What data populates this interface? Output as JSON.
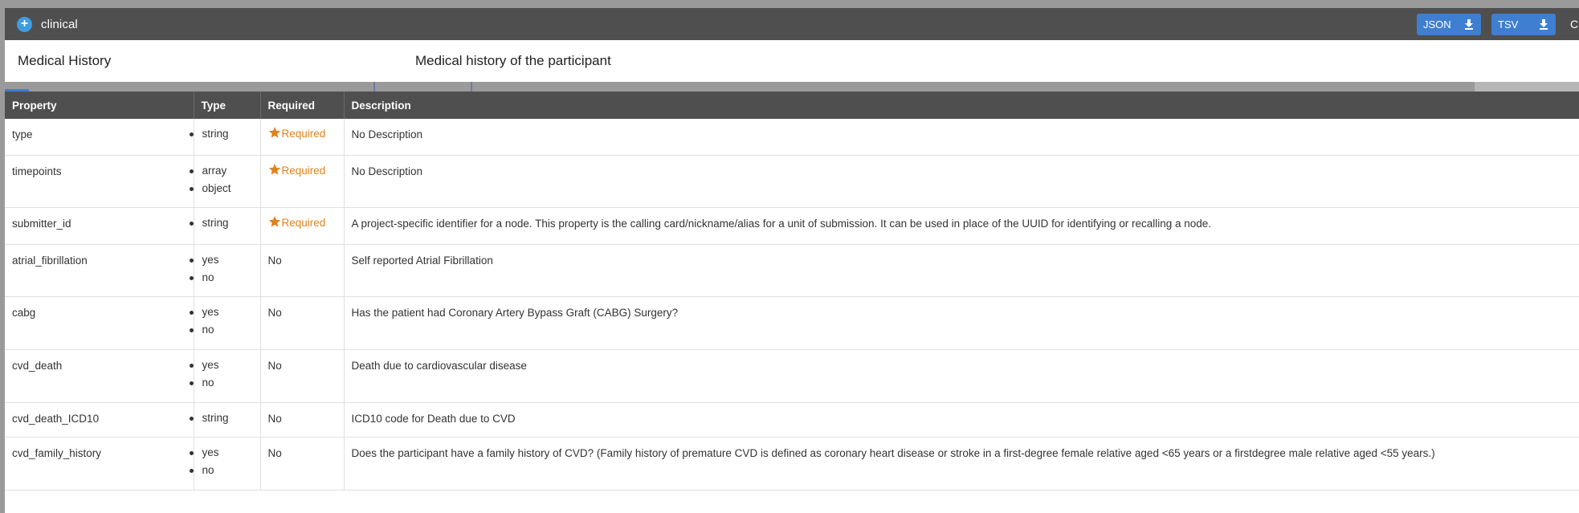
{
  "header": {
    "node_name": "clinical",
    "json_button": "JSON",
    "tsv_button": "TSV",
    "cut_text": "Cl"
  },
  "title": {
    "name": "Medical History",
    "description": "Medical history of the participant"
  },
  "table": {
    "columns": [
      "Property",
      "Type",
      "Required",
      "Description"
    ],
    "rows": [
      {
        "property": "type",
        "types": [
          "string"
        ],
        "required": "Required",
        "is_required": true,
        "description": "No Description"
      },
      {
        "property": "timepoints",
        "types": [
          "array",
          "object"
        ],
        "required": "Required",
        "is_required": true,
        "description": "No Description"
      },
      {
        "property": "submitter_id",
        "types": [
          "string"
        ],
        "required": "Required",
        "is_required": true,
        "description": "A project-specific identifier for a node. This property is the calling card/nickname/alias for a unit of submission. It can be used in place of the UUID for identifying or recalling a node."
      },
      {
        "property": "atrial_fibrillation",
        "types": [
          "yes",
          "no"
        ],
        "required": "No",
        "is_required": false,
        "description": "Self reported Atrial Fibrillation"
      },
      {
        "property": "cabg",
        "types": [
          "yes",
          "no"
        ],
        "required": "No",
        "is_required": false,
        "description": "Has the patient had Coronary Artery Bypass Graft (CABG) Surgery?"
      },
      {
        "property": "cvd_death",
        "types": [
          "yes",
          "no"
        ],
        "required": "No",
        "is_required": false,
        "description": "Death due to cardiovascular disease"
      },
      {
        "property": "cvd_death_ICD10",
        "types": [
          "string"
        ],
        "required": "No",
        "is_required": false,
        "description": "ICD10 code for Death due to CVD"
      },
      {
        "property": "cvd_family_history",
        "types": [
          "yes",
          "no"
        ],
        "required": "No",
        "is_required": false,
        "description": "Does the participant have a family history of CVD? (Family history of premature CVD is defined as coronary heart disease or stroke in a first-degree female relative aged <65 years or a firstdegree male relative aged <55 years.)"
      }
    ]
  },
  "colors": {
    "header_bg": "#4f4f4f",
    "button_bg": "#3f7fd1",
    "required_orange": "#e0821e",
    "node_icon_blue": "#3d9de0"
  },
  "icons": {
    "node": "plus-circle-icon",
    "download": "download-icon",
    "required": "star-icon"
  }
}
